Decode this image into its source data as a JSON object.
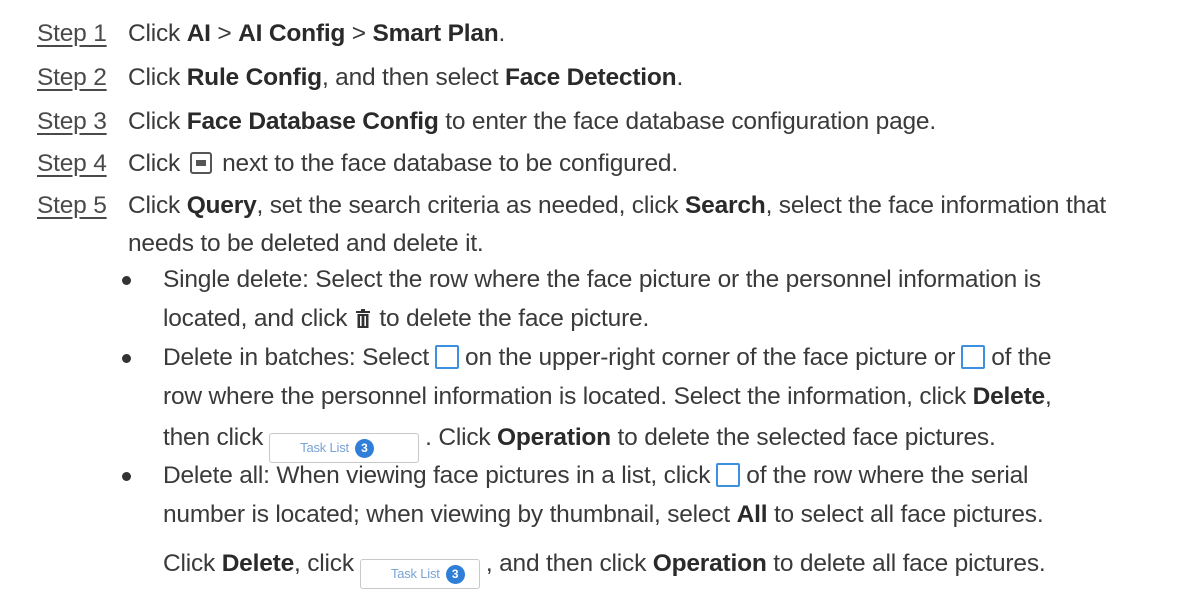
{
  "steps": [
    {
      "label": "Step 1",
      "t1": "Click ",
      "b1": "AI",
      "t2": " > ",
      "b2": "AI Config",
      "t3": " > ",
      "b3": "Smart Plan",
      "t4": "."
    },
    {
      "label": "Step 2",
      "t1": "Click ",
      "b1": "Rule Config",
      "t2": ", and then select ",
      "b2": "Face Detection",
      "t3": "."
    },
    {
      "label": "Step 3",
      "t1": "Click ",
      "b1": "Face Database Config",
      "t2": " to enter the face database configuration page."
    },
    {
      "label": "Step 4",
      "t1": "Click",
      "t2": "next to the face database to be configured."
    },
    {
      "label": "Step 5",
      "t1": "Click ",
      "b1": "Query",
      "t2": ", set the search criteria as needed, click ",
      "b2": "Search",
      "t3": ", select the face information that",
      "cont": "needs to be deleted and delete it."
    }
  ],
  "bullets": {
    "single": {
      "line1": "Single delete: Select the row where the face picture or the personnel information is",
      "line2a": "located, and click",
      "line2b": "to delete the face picture."
    },
    "batch": {
      "line1a": "Delete in batches: Select",
      "line1b": "on the upper-right corner of the face picture or",
      "line1c": "of the",
      "line2a": "row where the personnel information is located. Select the information, click ",
      "line2b": "Delete",
      "line2c": ",",
      "line3a": "then click",
      "line3b": ". Click ",
      "line3c": "Operation",
      "line3d": " to delete the selected face pictures."
    },
    "all": {
      "line1a": "Delete all: When viewing face pictures in a list, click",
      "line1b": "of the row where the serial",
      "line2a": "number is located; when viewing by thumbnail, select ",
      "line2b": "All",
      "line2c": " to select all face pictures.",
      "line3a": "Click ",
      "line3b": "Delete",
      "line3c": ", click",
      "line3d": ", and then click ",
      "line3e": "Operation",
      "line3f": " to delete all face pictures."
    }
  },
  "task_list_button": {
    "label": "Task List",
    "count": "3"
  },
  "icons": {
    "edit": "edit-icon",
    "delete": "trash-icon",
    "checkbox": "checkbox-icon"
  },
  "colors": {
    "accent": "#2f7fd8",
    "checkbox_border": "#3d8fe0"
  }
}
